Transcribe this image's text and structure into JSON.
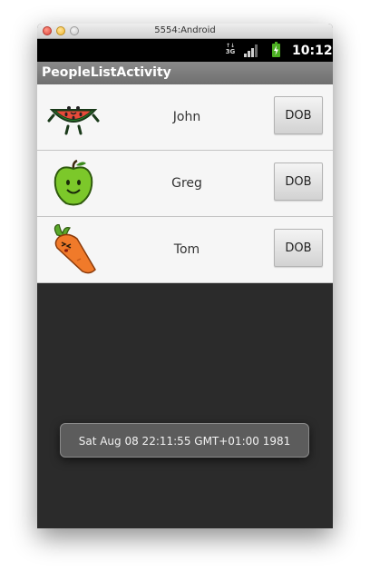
{
  "window": {
    "title": "5554:Android"
  },
  "status_bar": {
    "network": "3G",
    "time": "10:12",
    "icons": [
      "3g-data-icon",
      "signal-icon",
      "battery-charging-icon"
    ]
  },
  "app_bar": {
    "title": "PeopleListActivity"
  },
  "people": [
    {
      "name": "John",
      "icon": "watermelon-icon",
      "button_label": "DOB"
    },
    {
      "name": "Greg",
      "icon": "apple-icon",
      "button_label": "DOB"
    },
    {
      "name": "Tom",
      "icon": "carrot-icon",
      "button_label": "DOB"
    }
  ],
  "toast": {
    "text": "Sat Aug 08 22:11:55 GMT+01:00 1981"
  },
  "colors": {
    "list_background": "#f6f6f6",
    "screen_background": "#2b2b2b",
    "app_bar": "#7c7c7c",
    "battery_green": "#4caf22"
  }
}
